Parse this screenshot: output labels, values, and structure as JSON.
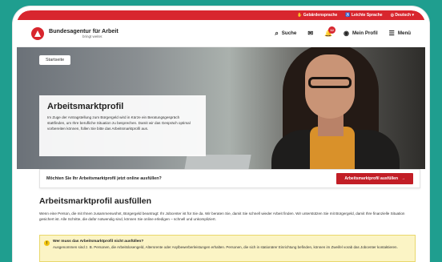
{
  "topbar": {
    "items": [
      "Gebärdensprache",
      "Leichte Sprache",
      "Deutsch"
    ]
  },
  "header": {
    "brand_title": "Bundesagentur für Arbeit",
    "brand_slogan": "bringt weiter.",
    "search_label": "Suche",
    "notification_count": "12",
    "profile_label": "Mein Profil",
    "menu_label": "Menü"
  },
  "hero": {
    "breadcrumb": "Startseite",
    "title": "Arbeitsmarktprofil",
    "text": "Im Zuge der Antragstellung zum Bürgergeld wird in Kürze ein Beratungsgespräch stattfinden, um Ihre berufliche Situation zu besprechen. Damit wir das Gespräch optimal vorbereiten können, füllen Sie bitte das Arbeitsmarktprofil aus."
  },
  "cta": {
    "question": "Möchten Sie Ihr Arbeitsmarktprofil jetzt online ausfüllen?",
    "button_label": "Arbeitsmarktprofil ausfüllen"
  },
  "section": {
    "title": "Arbeitsmarktprofil ausfüllen",
    "text": "Wenn eine Person, die mit Ihnen zusammenwohnt, Bürgergeld beantragt: Ihr Jobcenter ist für Sie da. Wir beraten Sie, damit Sie schnell wieder Arbeit finden. Wir unterstützen Sie mit Bürgergeld, damit Ihre finanzielle Situation gesichert ist. Alle Schritte, die dafür notwendig sind, können Sie online erledigen – schnell und unkompliziert."
  },
  "notice": {
    "heading": "Wer muss das Arbeitsmarktprofil nicht ausfüllen?",
    "text": "Ausgenommen sind z. B. Personen, die Arbeitslosengeld, Altersrente oder Asylbewerberleistungen erhalten. Personen, die sich in stationärer Einrichtung befinden, können im Zweifel vorab das Jobcenter kontaktieren."
  },
  "colors": {
    "brand_red": "#d8262e",
    "teal_background": "#1f9e8f",
    "notice_yellow": "#fbf4c5"
  }
}
